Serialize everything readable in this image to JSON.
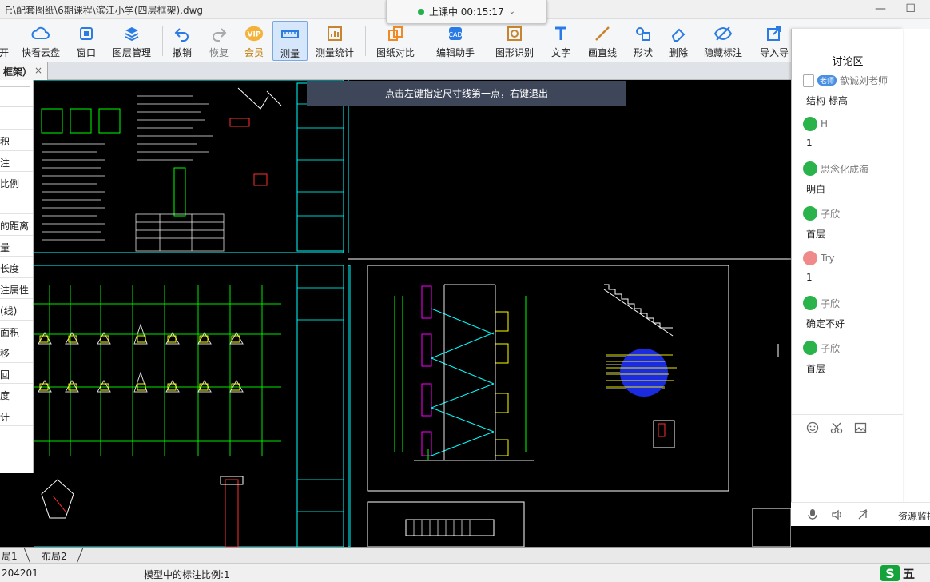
{
  "window": {
    "title": "F:\\配套图纸\\6期课程\\滨江小学(四层框架).dwg"
  },
  "live": {
    "status": "上课中 00:15:17"
  },
  "toolbar": {
    "items": [
      {
        "label": "开",
        "icon": "open-icon"
      },
      {
        "label": "快看云盘",
        "icon": "cloud-icon"
      },
      {
        "label": "窗口",
        "icon": "window-icon"
      },
      {
        "label": "图层管理",
        "icon": "layers-icon"
      },
      {
        "label": "撤销",
        "icon": "undo-icon"
      },
      {
        "label": "恢复",
        "icon": "redo-icon"
      },
      {
        "label": "会员",
        "icon": "vip-icon"
      },
      {
        "label": "测量",
        "icon": "measure-icon"
      },
      {
        "label": "测量统计",
        "icon": "measure-stats-icon"
      },
      {
        "label": "图纸对比",
        "icon": "compare-icon"
      },
      {
        "label": "编辑助手",
        "icon": "edit-assistant-icon"
      },
      {
        "label": "图形识别",
        "icon": "shape-recognition-icon"
      },
      {
        "label": "文字",
        "icon": "text-icon"
      },
      {
        "label": "画直线",
        "icon": "line-icon"
      },
      {
        "label": "形状",
        "icon": "shape-icon"
      },
      {
        "label": "删除",
        "icon": "eraser-icon"
      },
      {
        "label": "隐藏标注",
        "icon": "hide-annotation-icon"
      },
      {
        "label": "导入导",
        "icon": "import-icon"
      }
    ]
  },
  "tabs": {
    "current": "框架）"
  },
  "left_panel": {
    "items": [
      "积",
      "注",
      "比例",
      "",
      "的距离",
      "量",
      "长度",
      "注属性",
      "(线)",
      "面积",
      "移",
      "回",
      "度",
      "计"
    ]
  },
  "canvas": {
    "prompt": "点击左键指定尺寸线第一点，右键退出"
  },
  "discussion": {
    "title": "讨论区",
    "messages": [
      {
        "author": "歆诚刘老师",
        "badge": "老师",
        "text": "结构 标高"
      },
      {
        "author": "H",
        "text": "1"
      },
      {
        "author": "思念化成海",
        "text": "明白"
      },
      {
        "author": "子欣",
        "text": "首层"
      },
      {
        "author": "Try",
        "text": "1"
      },
      {
        "author": "子欣",
        "text": "确定不好"
      },
      {
        "author": "子欣",
        "text": "首层"
      }
    ],
    "footer_label": "资源监控"
  },
  "layout_tabs": [
    "局1",
    "布局2"
  ],
  "status": {
    "coordinate": "204201",
    "scale_text": "模型中的标注比例:1"
  },
  "ime": {
    "label": "五"
  },
  "colors": {
    "canvas_bg": "#000000",
    "accent": "#2b6fd6",
    "drawing_cyan": "#00ffff",
    "drawing_green": "#00ff00",
    "drawing_yellow": "#ffff00",
    "drawing_magenta": "#ff00ff"
  }
}
